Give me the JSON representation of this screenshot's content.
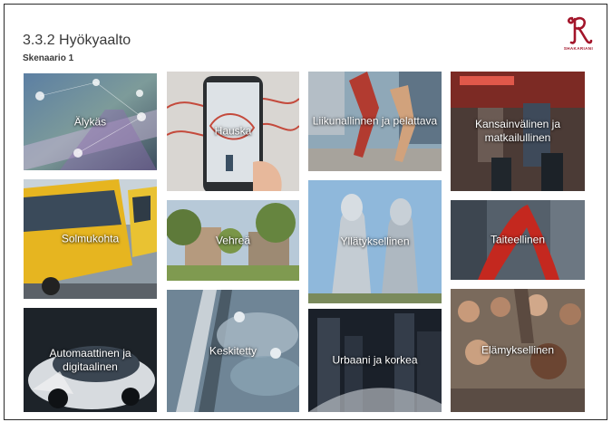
{
  "page": {
    "title": "3.3.2 Hyökyaalto",
    "subtitle": "Skenaario 1",
    "logo_text": "SHAKARIANI",
    "accent_color": "#a3152a"
  },
  "tiles": [
    {
      "label": "Älykäs"
    },
    {
      "label": "Hauska"
    },
    {
      "label": "Liikunallinnen ja pelattava"
    },
    {
      "label": "Kansainvälinen ja matkailullinen"
    },
    {
      "label": "Solmukohta"
    },
    {
      "label": "Vehreä"
    },
    {
      "label": "Yllätyksellinen"
    },
    {
      "label": "Taiteellinen"
    },
    {
      "label": "Automaattinen ja digitaalinen"
    },
    {
      "label": "Keskitetty"
    },
    {
      "label": "Urbaani ja korkea"
    },
    {
      "label": "Elämyksellinen"
    }
  ]
}
